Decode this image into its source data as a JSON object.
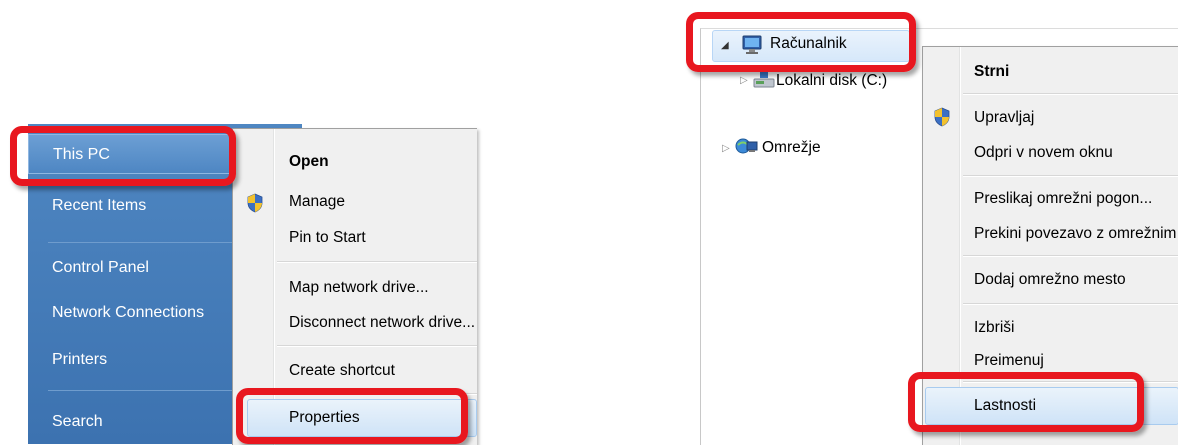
{
  "start_menu": {
    "items": [
      {
        "label": "This PC"
      },
      {
        "label": "Recent Items"
      },
      {
        "label": "Control Panel"
      },
      {
        "label": "Network Connections"
      },
      {
        "label": "Printers"
      },
      {
        "label": "Search"
      }
    ]
  },
  "left_context_menu": {
    "items": [
      {
        "label": "Open",
        "bold": true
      },
      {
        "label": "Manage",
        "icon": "uac-shield-icon"
      },
      {
        "label": "Pin to Start"
      },
      {
        "label": "Map network drive..."
      },
      {
        "label": "Disconnect network drive..."
      },
      {
        "label": "Create shortcut"
      },
      {
        "label": "Properties"
      }
    ]
  },
  "explorer_tree": {
    "computer": "Računalnik",
    "local_disk": "Lokalni disk (C:)",
    "network": "Omrežje"
  },
  "right_context_menu": {
    "items": [
      {
        "label": "Strni",
        "bold": true
      },
      {
        "label": "Upravljaj",
        "icon": "uac-shield-icon"
      },
      {
        "label": "Odpri v novem oknu"
      },
      {
        "label": "Preslikaj omrežni pogon..."
      },
      {
        "label": "Prekini povezavo z omrežnim pogonom..."
      },
      {
        "label": "Dodaj omrežno mesto"
      },
      {
        "label": "Izbriši"
      },
      {
        "label": "Preimenuj"
      },
      {
        "label": "Lastnosti"
      }
    ]
  },
  "colors": {
    "highlight_box": "#e8171f",
    "start_menu_blue": "#4a82bf"
  }
}
